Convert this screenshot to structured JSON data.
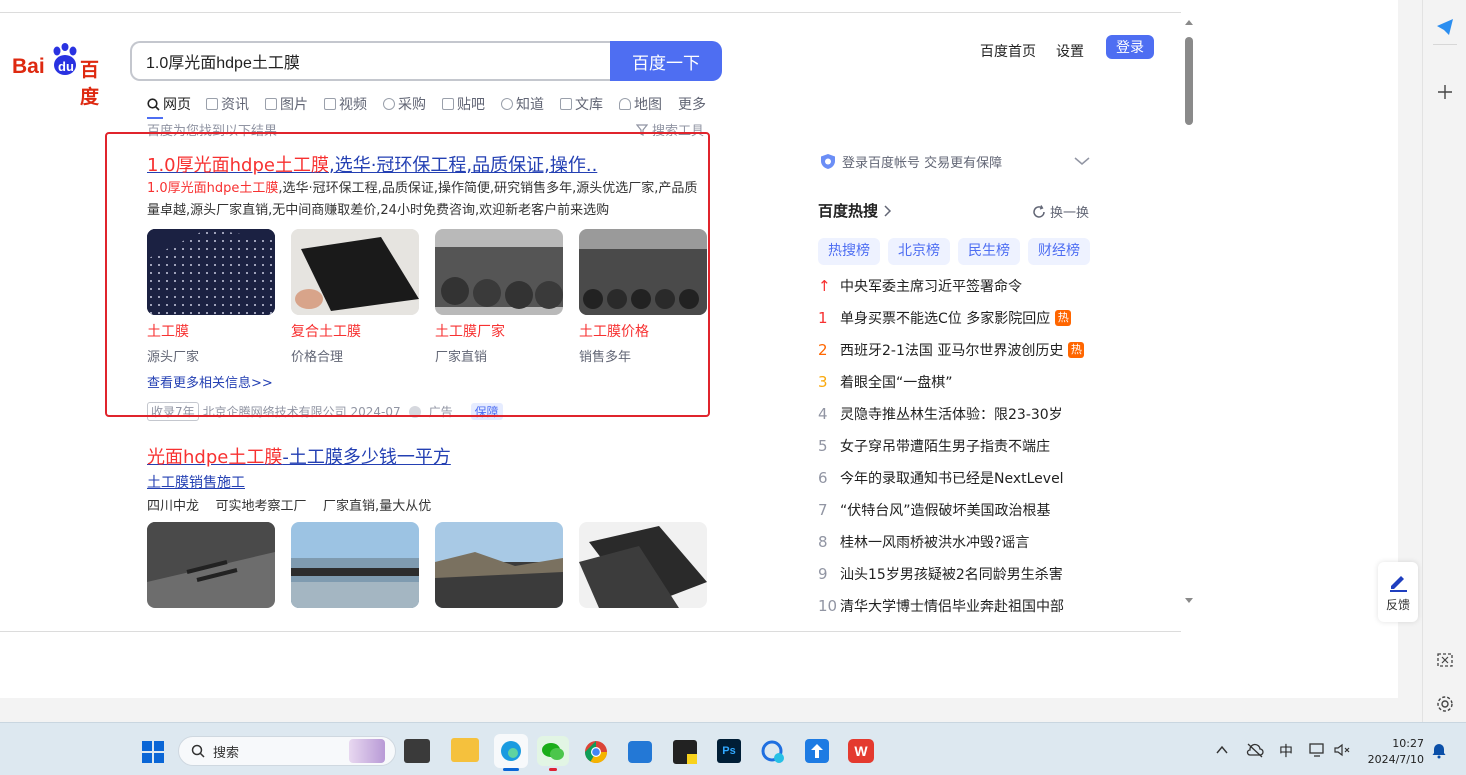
{
  "header": {
    "logo_text": "Bai du 百度",
    "logo_left": "Bai",
    "logo_mid": "du",
    "logo_right": "百度",
    "query": "1.0厚光面hdpe土工膜",
    "search_button": "百度一下",
    "links": [
      "百度首页",
      "设置"
    ],
    "login": "登录"
  },
  "tabs": [
    "网页",
    "资讯",
    "图片",
    "视频",
    "采购",
    "贴吧",
    "知道",
    "文库",
    "地图",
    "更多"
  ],
  "results_meta": {
    "found_text": "百度为您找到以下结果",
    "tools": "搜索工具"
  },
  "ad_result": {
    "title_hl": "1.0厚光面hdpe土工膜",
    "title_rest": ",选华·冠环保工程,品质保证,操作..",
    "desc_hl": "1.0厚光面hdpe土工膜",
    "desc_rest": ",选华·冠环保工程,品质保证,操作简便,研究销售多年,源头优选厂家,产品质量卓越,源头厂家直销,无中间商赚取差价,24小时免费咨询,欢迎新老客户前来选购",
    "items": [
      {
        "hl": "土工膜",
        "rest": "",
        "sub": "源头厂家"
      },
      {
        "hl": "复合土工膜",
        "rest": "",
        "sub": "价格合理"
      },
      {
        "hl": "土工膜",
        "rest": "厂家",
        "sub": "厂家直销"
      },
      {
        "hl": "土工膜",
        "rest": "价格",
        "sub": "销售多年"
      }
    ],
    "more_link": "查看更多相关信息>>",
    "footer_age": "收录7年",
    "footer_company": "北京企腾网络技术有限公司 2024-07",
    "footer_ad": "广告",
    "footer_badge": "保障"
  },
  "result2": {
    "title_hl": "光面hdpe土工膜",
    "title_rest": "-土工膜多少钱一平方",
    "sublink": "土工膜销售施工",
    "tags": "四川中龙    可实地考察工厂    厂家直销,量大从优"
  },
  "sidebar": {
    "login_prompt": "登录百度帐号 交易更有保障",
    "hot_title": "百度热搜",
    "refresh": "换一换",
    "hot_tabs": [
      "热搜榜",
      "北京榜",
      "民生榜",
      "财经榜"
    ],
    "hot_list": [
      {
        "rank": "↑",
        "text": "中央军委主席习近平签署命令",
        "hot": ""
      },
      {
        "rank": "1",
        "text": "单身买票不能选C位 多家影院回应",
        "hot": "热"
      },
      {
        "rank": "2",
        "text": "西班牙2-1法国 亚马尔世界波创历史",
        "hot": "热"
      },
      {
        "rank": "3",
        "text": "着眼全国“一盘棋”",
        "hot": ""
      },
      {
        "rank": "4",
        "text": "灵隐寺推丛林生活体验：限23-30岁",
        "hot": ""
      },
      {
        "rank": "5",
        "text": "女子穿吊带遭陌生男子指责不端庄",
        "hot": ""
      },
      {
        "rank": "6",
        "text": "今年的录取通知书已经是NextLevel",
        "hot": ""
      },
      {
        "rank": "7",
        "text": "“伏特台风”造假破坏美国政治根基",
        "hot": ""
      },
      {
        "rank": "8",
        "text": "桂林一风雨桥被洪水冲毁?谣言",
        "hot": ""
      },
      {
        "rank": "9",
        "text": "汕头15岁男孩疑被2名同龄男生杀害",
        "hot": ""
      },
      {
        "rank": "10",
        "text": "清华大学博士情侣毕业奔赴祖国中部",
        "hot": ""
      }
    ],
    "rank_colors": {
      "top": "#f73131",
      "2": "#ff6600",
      "3": "#faa90e",
      "rest": "#9195a3"
    }
  },
  "feedback": "反馈",
  "taskbar": {
    "search_placeholder": "搜索",
    "time": "10:27",
    "date": "2024/7/10",
    "ime": "中"
  },
  "colors": {
    "accent": "#4e6ef2",
    "highlight": "#f73131",
    "link": "#2440b3",
    "ad_frame": "#e0242c"
  }
}
